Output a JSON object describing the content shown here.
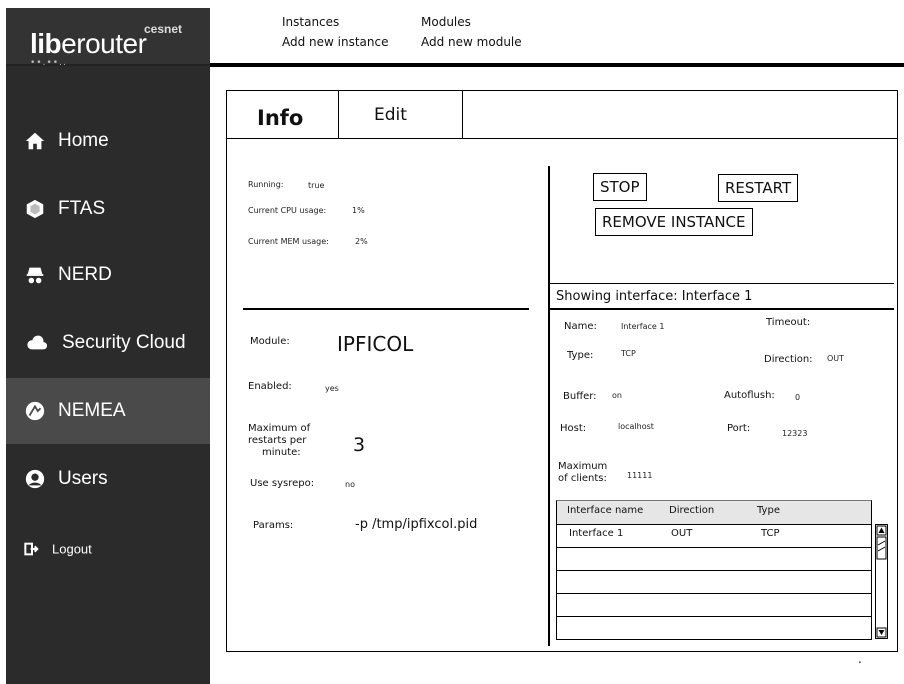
{
  "brand": {
    "name_bold": "lib",
    "name_rest": "erouter",
    "sub": "cesnet",
    "dots": "••.••.."
  },
  "sidebar": {
    "items": [
      {
        "label": "Home",
        "icon": "home-icon"
      },
      {
        "label": "FTAS",
        "icon": "hexagon-icon"
      },
      {
        "label": "NERD",
        "icon": "incognito-icon"
      },
      {
        "label": "Security Cloud",
        "icon": "cloud-icon"
      },
      {
        "label": "NEMEA",
        "icon": "nemea-icon",
        "active": true
      },
      {
        "label": "Users",
        "icon": "user-icon"
      }
    ],
    "logout": {
      "label": "Logout",
      "icon": "logout-icon"
    }
  },
  "topmenu": {
    "instances": "Instances",
    "add_instance": "Add new instance",
    "modules": "Modules",
    "add_module": "Add new module"
  },
  "tabs": {
    "info": "Info",
    "edit": "Edit"
  },
  "status": {
    "running_label": "Running:",
    "running_value": "true",
    "cpu_label": "Current CPU usage:",
    "cpu_value": "1%",
    "mem_label": "Current MEM usage:",
    "mem_value": "2%"
  },
  "buttons": {
    "stop": "STOP",
    "restart": "RESTART",
    "remove": "REMOVE INSTANCE"
  },
  "module": {
    "module_label": "Module:",
    "module_value": "IPFICOL",
    "enabled_label": "Enabled:",
    "enabled_value": "yes",
    "max_restarts_label_1": "Maximum of",
    "max_restarts_label_2": "restarts per",
    "max_restarts_label_3": "minute:",
    "max_restarts_value": "3",
    "sysrepo_label": "Use sysrepo:",
    "sysrepo_value": "no",
    "params_label": "Params:",
    "params_value": "-p /tmp/ipfixcol.pid"
  },
  "interface": {
    "heading": "Showing interface: Interface 1",
    "name_label": "Name:",
    "name_value": "Interface 1",
    "timeout_label": "Timeout:",
    "type_label": "Type:",
    "type_value": "TCP",
    "direction_label": "Direction:",
    "direction_value": "OUT",
    "buffer_label": "Buffer:",
    "buffer_value": "on",
    "autoflush_label": "Autoflush:",
    "autoflush_value": "0",
    "host_label": "Host:",
    "host_value": "localhost",
    "port_label": "Port:",
    "port_value": "12323",
    "max_clients_label_1": "Maximum",
    "max_clients_label_2": "of clients:",
    "max_clients_value": "11111"
  },
  "table": {
    "headers": [
      "Interface name",
      "Direction",
      "Type"
    ],
    "rows": [
      [
        "Interface 1",
        "OUT",
        "TCP"
      ]
    ]
  },
  "footer": {
    "dot": "."
  }
}
